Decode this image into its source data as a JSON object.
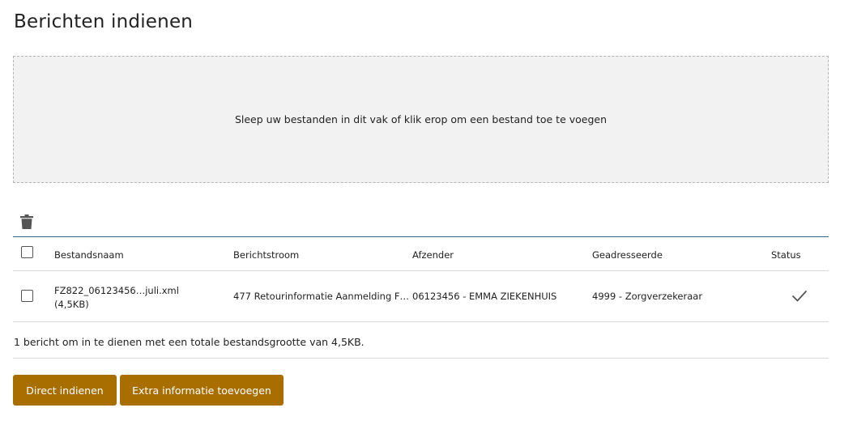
{
  "page": {
    "title": "Berichten indienen"
  },
  "dropzone": {
    "text": "Sleep uw bestanden in dit vak of klik erop om een bestand toe te voegen"
  },
  "table": {
    "headers": {
      "filename": "Bestandsnaam",
      "stream": "Berichtstroom",
      "sender": "Afzender",
      "addressee": "Geadresseerde",
      "status": "Status"
    },
    "rows": [
      {
        "filename": "FZ822_06123456…juli.xml",
        "size": "(4,5KB)",
        "stream": "477 Retourinformatie Aanmelding F…",
        "sender": "06123456 - EMMA ZIEKENHUIS",
        "addressee": "4999 - Zorgverzekeraar",
        "status_icon": "checkmark-icon"
      }
    ]
  },
  "summary": "1 bericht om in te dienen met een totale bestandsgrootte van 4,5KB.",
  "buttons": {
    "direct": "Direct indienen",
    "extra": "Extra informatie toevoegen"
  },
  "colors": {
    "accent": "#a86f00",
    "table_top_border": "#2e6b8a",
    "dropzone_bg": "#f2f2f2"
  }
}
